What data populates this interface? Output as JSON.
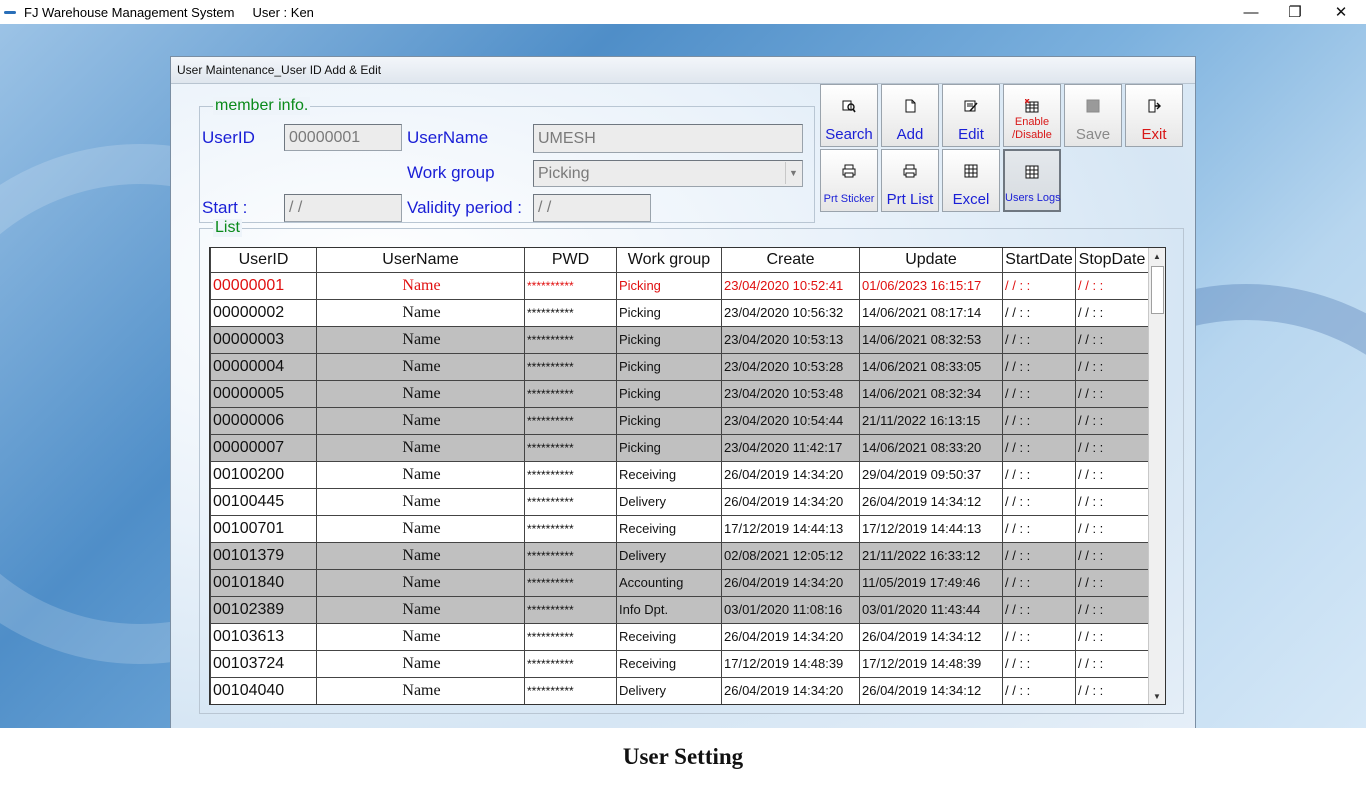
{
  "app": {
    "title": "FJ Warehouse Management System",
    "user": "User : Ken",
    "window_controls": {
      "minimize": "—",
      "restore": "❐",
      "close": "✕"
    }
  },
  "dialog": {
    "title": "User Maintenance_User ID Add & Edit"
  },
  "member_info": {
    "legend": "member info.",
    "userid_label": "UserID",
    "userid_value": "00000001",
    "username_label": "UserName",
    "username_value": "UMESH",
    "workgroup_label": "Work group",
    "workgroup_value": "Picking",
    "start_label": "Start :",
    "start_value": " / /",
    "validity_label": "Validity period :",
    "validity_value": " / /"
  },
  "toolbar": {
    "search": "Search",
    "add": "Add",
    "edit": "Edit",
    "enable_disable_1": "Enable",
    "enable_disable_2": "/Disable",
    "save": "Save",
    "exit": "Exit",
    "prt_sticker": "Prt Sticker",
    "prt_list": "Prt List",
    "excel": "Excel",
    "users_logs": "Users Logs"
  },
  "list": {
    "legend": "List",
    "columns": [
      "UserID",
      "UserName",
      "PWD",
      "Work group",
      "Create",
      "Update",
      "StartDate",
      "StopDate"
    ],
    "rows": [
      {
        "id": "00000001",
        "name": "Name",
        "pwd": "**********",
        "group": "Picking",
        "create": "23/04/2020 10:52:41",
        "update": "01/06/2023 16:15:17",
        "start": "/ /    : :",
        "stop": "/ /    : :",
        "style": "sel"
      },
      {
        "id": "00000002",
        "name": "Name",
        "pwd": "**********",
        "group": "Picking",
        "create": "23/04/2020 10:56:32",
        "update": "14/06/2021 08:17:14",
        "start": "/ /    : :",
        "stop": "/ /    : :",
        "style": "white"
      },
      {
        "id": "00000003",
        "name": "Name",
        "pwd": "**********",
        "group": "Picking",
        "create": "23/04/2020 10:53:13",
        "update": "14/06/2021 08:32:53",
        "start": "/ /    : :",
        "stop": "/ /    : :",
        "style": "gray"
      },
      {
        "id": "00000004",
        "name": "Name",
        "pwd": "**********",
        "group": "Picking",
        "create": "23/04/2020 10:53:28",
        "update": "14/06/2021 08:33:05",
        "start": "/ /    : :",
        "stop": "/ /    : :",
        "style": "gray"
      },
      {
        "id": "00000005",
        "name": "Name",
        "pwd": "**********",
        "group": "Picking",
        "create": "23/04/2020 10:53:48",
        "update": "14/06/2021 08:32:34",
        "start": "/ /    : :",
        "stop": "/ /    : :",
        "style": "gray"
      },
      {
        "id": "00000006",
        "name": "Name",
        "pwd": "**********",
        "group": "Picking",
        "create": "23/04/2020 10:54:44",
        "update": "21/11/2022 16:13:15",
        "start": "/ /    : :",
        "stop": "/ /    : :",
        "style": "gray"
      },
      {
        "id": "00000007",
        "name": "Name",
        "pwd": "**********",
        "group": "Picking",
        "create": "23/04/2020 11:42:17",
        "update": "14/06/2021 08:33:20",
        "start": "/ /    : :",
        "stop": "/ /    : :",
        "style": "gray"
      },
      {
        "id": "00100200",
        "name": "Name",
        "pwd": "**********",
        "group": "Receiving",
        "create": "26/04/2019 14:34:20",
        "update": "29/04/2019 09:50:37",
        "start": "/ /    : :",
        "stop": "/ /    : :",
        "style": "white"
      },
      {
        "id": "00100445",
        "name": "Name",
        "pwd": "**********",
        "group": "Delivery",
        "create": "26/04/2019 14:34:20",
        "update": "26/04/2019 14:34:12",
        "start": "/ /    : :",
        "stop": "/ /    : :",
        "style": "white"
      },
      {
        "id": "00100701",
        "name": "Name",
        "pwd": "**********",
        "group": "Receiving",
        "create": "17/12/2019 14:44:13",
        "update": "17/12/2019 14:44:13",
        "start": "/ /    : :",
        "stop": "/ /    : :",
        "style": "white"
      },
      {
        "id": "00101379",
        "name": "Name",
        "pwd": "**********",
        "group": "Delivery",
        "create": "02/08/2021 12:05:12",
        "update": "21/11/2022 16:33:12",
        "start": "/ /    : :",
        "stop": "/ /    : :",
        "style": "gray"
      },
      {
        "id": "00101840",
        "name": "Name",
        "pwd": "**********",
        "group": "Accounting",
        "create": "26/04/2019 14:34:20",
        "update": "11/05/2019 17:49:46",
        "start": "/ /    : :",
        "stop": "/ /    : :",
        "style": "gray"
      },
      {
        "id": "00102389",
        "name": "Name",
        "pwd": "**********",
        "group": "Info Dpt.",
        "create": "03/01/2020 11:08:16",
        "update": "03/01/2020 11:43:44",
        "start": "/ /    : :",
        "stop": "/ /    : :",
        "style": "gray"
      },
      {
        "id": "00103613",
        "name": "Name",
        "pwd": "**********",
        "group": "Receiving",
        "create": "26/04/2019 14:34:20",
        "update": "26/04/2019 14:34:12",
        "start": "/ /    : :",
        "stop": "/ /    : :",
        "style": "white"
      },
      {
        "id": "00103724",
        "name": "Name",
        "pwd": "**********",
        "group": "Receiving",
        "create": "17/12/2019 14:48:39",
        "update": "17/12/2019 14:48:39",
        "start": "/ /    : :",
        "stop": "/ /    : :",
        "style": "white"
      },
      {
        "id": "00104040",
        "name": "Name",
        "pwd": "**********",
        "group": "Delivery",
        "create": "26/04/2019 14:34:20",
        "update": "26/04/2019 14:34:12",
        "start": "/ /    : :",
        "stop": "/ /    : :",
        "style": "white"
      }
    ]
  },
  "caption": "User Setting",
  "colors": {
    "label_blue": "#1a1fd6",
    "legend_green": "#0a8a1a",
    "selected_red": "#e01010",
    "row_gray": "#c0c0c0"
  },
  "icons": [
    "search-icon",
    "add-doc-icon",
    "edit-icon",
    "enable-disable-icon",
    "save-icon",
    "exit-icon",
    "printer-icon",
    "excel-icon",
    "logs-icon"
  ]
}
